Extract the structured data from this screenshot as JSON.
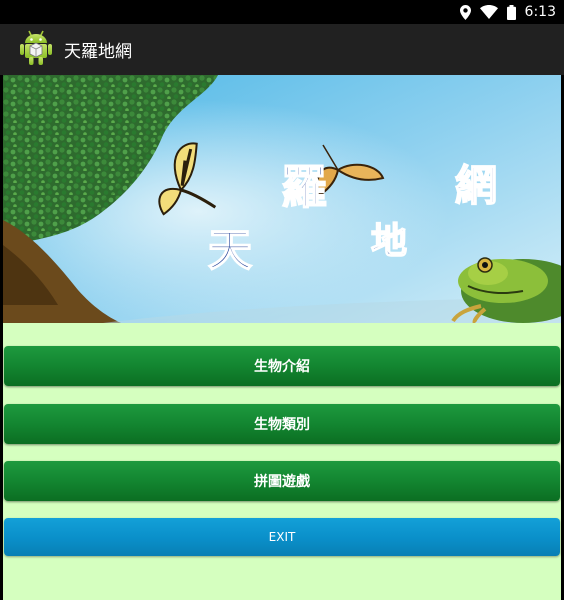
{
  "status_bar": {
    "time": "6:13",
    "icons": [
      "location-icon",
      "wifi-icon",
      "battery-icon"
    ]
  },
  "action_bar": {
    "title": "天羅地網",
    "icon": "android-robot-icon"
  },
  "banner": {
    "title_chars": [
      "天",
      "羅",
      "地",
      "網"
    ]
  },
  "buttons": {
    "intro": "生物介紹",
    "category": "生物類別",
    "puzzle": "拼圖遊戲",
    "exit": "EXIT"
  },
  "colors": {
    "content_bg": "#d5ffbf",
    "green_button": "#148832",
    "exit_button": "#0a8fc9",
    "action_bar": "#212121"
  }
}
